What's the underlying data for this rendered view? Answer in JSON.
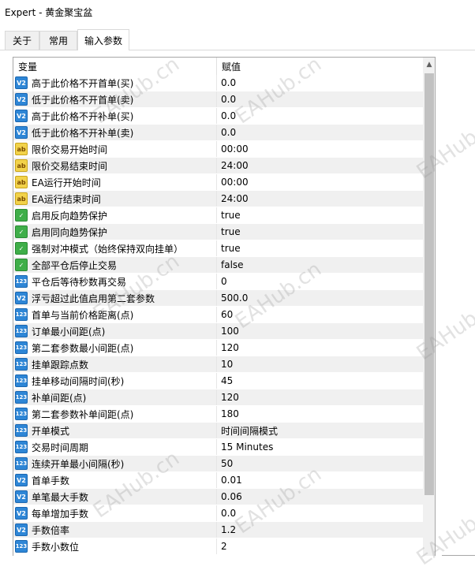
{
  "window": {
    "title": "Expert - 黄金聚宝盆"
  },
  "tabs": [
    {
      "label": "关于",
      "active": false
    },
    {
      "label": "常用",
      "active": false
    },
    {
      "label": "输入参数",
      "active": true
    }
  ],
  "grid": {
    "headers": {
      "variable": "变量",
      "value": "赋值"
    },
    "rows": [
      {
        "type": "double",
        "icon": "V2",
        "name": "高于此价格不开首单(买)",
        "value": "0.0"
      },
      {
        "type": "double",
        "icon": "V2",
        "name": "低于此价格不开首单(卖)",
        "value": "0.0"
      },
      {
        "type": "double",
        "icon": "V2",
        "name": "高于此价格不开补单(买)",
        "value": "0.0"
      },
      {
        "type": "double",
        "icon": "V2",
        "name": "低于此价格不开补单(卖)",
        "value": "0.0"
      },
      {
        "type": "string",
        "icon": "ab",
        "name": "限价交易开始时间",
        "value": "00:00"
      },
      {
        "type": "string",
        "icon": "ab",
        "name": "限价交易结束时间",
        "value": "24:00"
      },
      {
        "type": "string",
        "icon": "ab",
        "name": "EA运行开始时间",
        "value": "00:00"
      },
      {
        "type": "string",
        "icon": "ab",
        "name": "EA运行结束时间",
        "value": "24:00"
      },
      {
        "type": "bool",
        "icon": "✓",
        "name": "启用反向趋势保护",
        "value": "true"
      },
      {
        "type": "bool",
        "icon": "✓",
        "name": "启用同向趋势保护",
        "value": "true"
      },
      {
        "type": "bool",
        "icon": "✓",
        "name": "强制对冲模式（始终保持双向挂单）",
        "value": "true"
      },
      {
        "type": "bool",
        "icon": "✓",
        "name": "全部平仓后停止交易",
        "value": "false"
      },
      {
        "type": "int",
        "icon": "123",
        "name": "平仓后等待秒数再交易",
        "value": "0"
      },
      {
        "type": "double",
        "icon": "V2",
        "name": "浮亏超过此值启用第二套参数",
        "value": "500.0"
      },
      {
        "type": "int",
        "icon": "123",
        "name": "首单与当前价格距离(点)",
        "value": "60"
      },
      {
        "type": "int",
        "icon": "123",
        "name": "订单最小间距(点)",
        "value": "100"
      },
      {
        "type": "int",
        "icon": "123",
        "name": "第二套参数最小间距(点)",
        "value": "120"
      },
      {
        "type": "int",
        "icon": "123",
        "name": "挂单跟踪点数",
        "value": "10"
      },
      {
        "type": "int",
        "icon": "123",
        "name": "挂单移动间隔时间(秒)",
        "value": "45"
      },
      {
        "type": "int",
        "icon": "123",
        "name": "补单间距(点)",
        "value": "120"
      },
      {
        "type": "int",
        "icon": "123",
        "name": "第二套参数补单间距(点)",
        "value": "180"
      },
      {
        "type": "int",
        "icon": "123",
        "name": "开单模式",
        "value": "时间间隔模式"
      },
      {
        "type": "int",
        "icon": "123",
        "name": "交易时间周期",
        "value": "15 Minutes"
      },
      {
        "type": "int",
        "icon": "123",
        "name": "连续开单最小间隔(秒)",
        "value": "50"
      },
      {
        "type": "double",
        "icon": "V2",
        "name": "首单手数",
        "value": "0.01"
      },
      {
        "type": "double",
        "icon": "V2",
        "name": "单笔最大手数",
        "value": "0.06"
      },
      {
        "type": "double",
        "icon": "V2",
        "name": "每单增加手数",
        "value": "0.0"
      },
      {
        "type": "double",
        "icon": "V2",
        "name": "手数倍率",
        "value": "1.2"
      },
      {
        "type": "int",
        "icon": "123",
        "name": "手数小数位",
        "value": "2"
      }
    ]
  },
  "watermark": "EAHub.cn"
}
